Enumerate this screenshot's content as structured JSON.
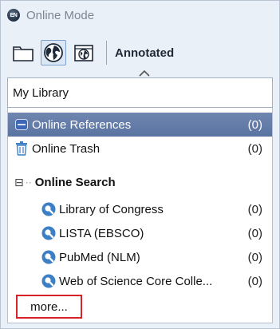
{
  "window": {
    "title": "Online Mode"
  },
  "toolbar": {
    "buttons": [
      {
        "icon": "folder-icon"
      },
      {
        "icon": "globe-icon"
      },
      {
        "icon": "globe-library-icon"
      }
    ],
    "label": "Annotated"
  },
  "library_selector": {
    "value": "My Library"
  },
  "tree": {
    "online_references": {
      "label": "Online References",
      "count": "(0)"
    },
    "online_trash": {
      "label": "Online Trash",
      "count": "(0)"
    },
    "online_search": {
      "label": "Online Search",
      "expander": "⊟",
      "items": [
        {
          "label": "Library of Congress",
          "count": "(0)"
        },
        {
          "label": "LISTA (EBSCO)",
          "count": "(0)"
        },
        {
          "label": "PubMed (NLM)",
          "count": "(0)"
        },
        {
          "label": "Web of Science Core Colle...",
          "count": "(0)"
        }
      ],
      "more_label": "more..."
    }
  },
  "colors": {
    "selected_row": "#6279a6",
    "highlight_border": "#d62228",
    "search_icon": "#3d7fc4"
  }
}
